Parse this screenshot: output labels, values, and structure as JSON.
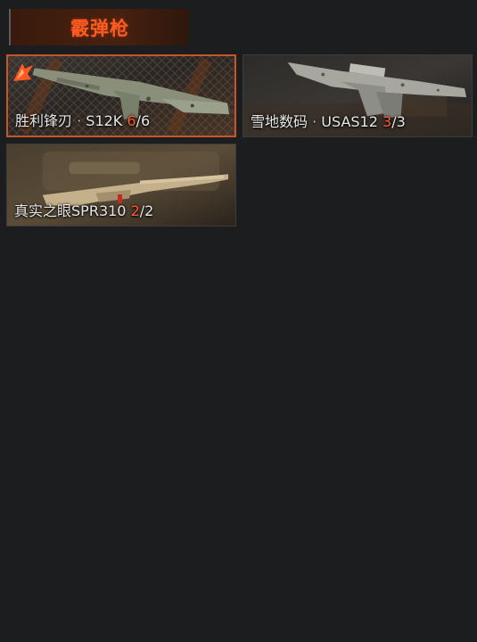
{
  "header": {
    "category_title": "霰弹枪"
  },
  "weapons": [
    {
      "skin_name": "胜利锋刃",
      "separator": "·",
      "model": "S12K",
      "owned": "6",
      "total": "6",
      "selected": true,
      "icon": "rarity-badge-icon"
    },
    {
      "skin_name": "雪地数码",
      "separator": "·",
      "model": "USAS12",
      "owned": "3",
      "total": "3",
      "selected": false
    },
    {
      "skin_name": "真实之眼",
      "separator": "",
      "model": "SPR310",
      "owned": "2",
      "total": "2",
      "selected": false
    }
  ],
  "colors": {
    "accent": "#ff5a1f",
    "count_highlight": "#ff5a2e",
    "selected_border": "#c4562a",
    "background": "#1c1d1f"
  }
}
